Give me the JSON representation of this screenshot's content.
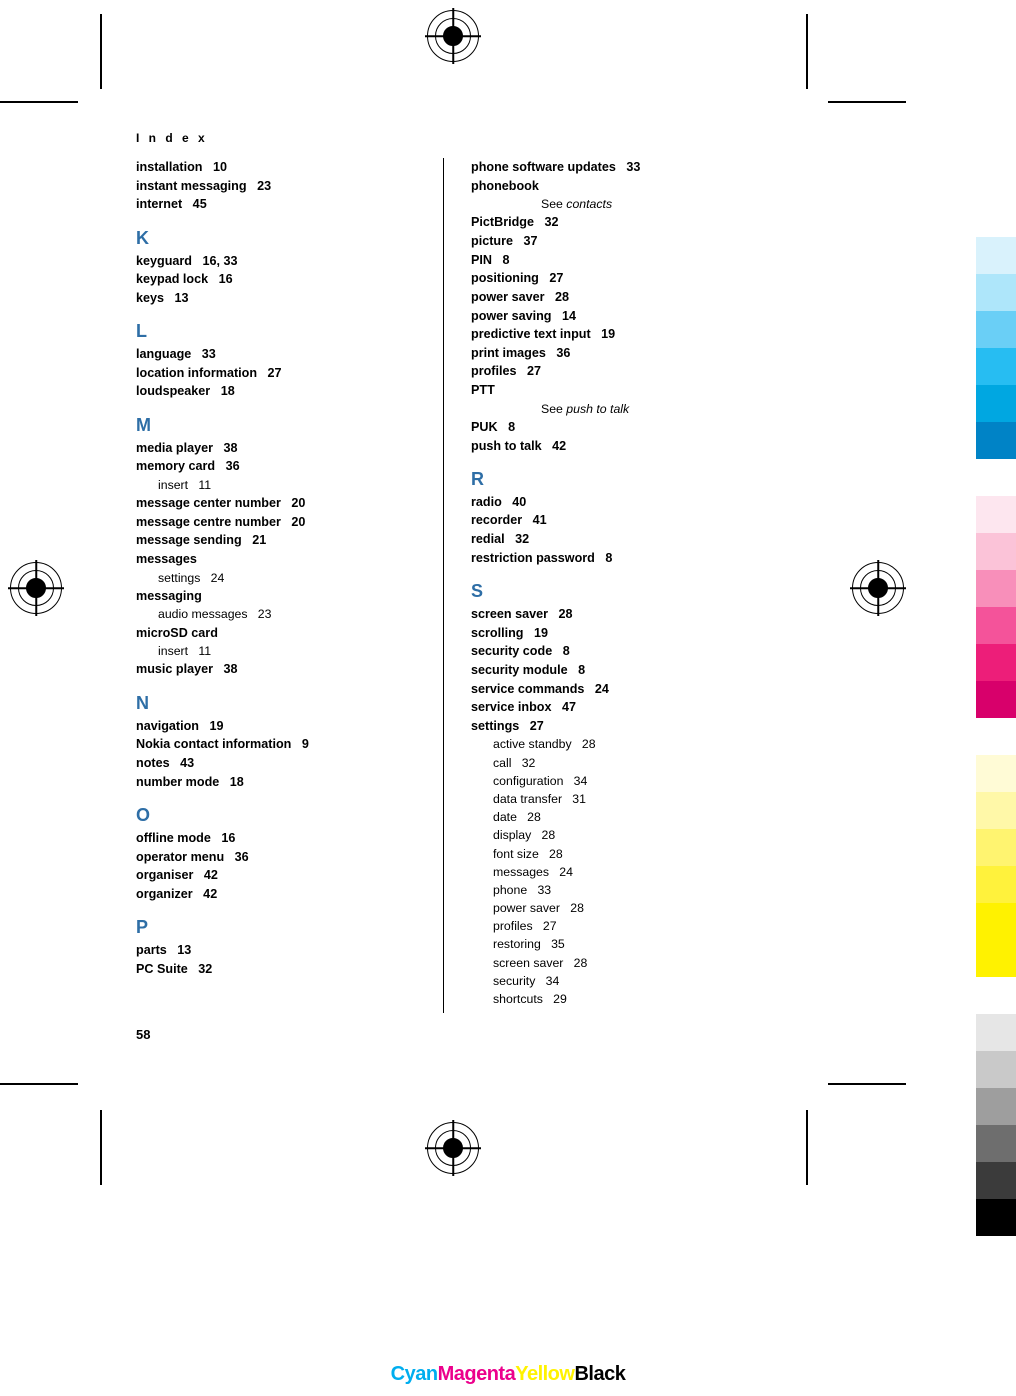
{
  "document": {
    "header": "I n d e x",
    "page_number": "58"
  },
  "columns": {
    "left": [
      {
        "type": "entry",
        "text": "installation",
        "page": "10"
      },
      {
        "type": "entry",
        "text": "instant messaging",
        "page": "23"
      },
      {
        "type": "entry",
        "text": "internet",
        "page": "45"
      },
      {
        "type": "letter",
        "text": "K"
      },
      {
        "type": "entry",
        "text": "keyguard",
        "page": "16, 33"
      },
      {
        "type": "entry",
        "text": "keypad lock",
        "page": "16"
      },
      {
        "type": "entry",
        "text": "keys",
        "page": "13"
      },
      {
        "type": "letter",
        "text": "L"
      },
      {
        "type": "entry",
        "text": "language",
        "page": "33"
      },
      {
        "type": "entry",
        "text": "location information",
        "page": "27"
      },
      {
        "type": "entry",
        "text": "loudspeaker",
        "page": "18"
      },
      {
        "type": "letter",
        "text": "M"
      },
      {
        "type": "entry",
        "text": "media player",
        "page": "38"
      },
      {
        "type": "entry",
        "text": "memory card",
        "page": "36"
      },
      {
        "type": "sub",
        "text": "insert",
        "page": "11"
      },
      {
        "type": "entry",
        "text": "message center number",
        "page": "20"
      },
      {
        "type": "entry",
        "text": "message centre number",
        "page": "20"
      },
      {
        "type": "entry",
        "text": "message sending",
        "page": "21"
      },
      {
        "type": "entry",
        "text": "messages",
        "page": ""
      },
      {
        "type": "sub",
        "text": "settings",
        "page": "24"
      },
      {
        "type": "entry",
        "text": "messaging",
        "page": ""
      },
      {
        "type": "sub",
        "text": "audio messages",
        "page": "23"
      },
      {
        "type": "entry",
        "text": "microSD card",
        "page": ""
      },
      {
        "type": "sub",
        "text": "insert",
        "page": "11"
      },
      {
        "type": "entry",
        "text": "music player",
        "page": "38"
      },
      {
        "type": "letter",
        "text": "N"
      },
      {
        "type": "entry",
        "text": "navigation",
        "page": "19"
      },
      {
        "type": "entry",
        "text": "Nokia contact information",
        "page": "9"
      },
      {
        "type": "entry",
        "text": "notes",
        "page": "43"
      },
      {
        "type": "entry",
        "text": "number mode",
        "page": "18"
      },
      {
        "type": "letter",
        "text": "O"
      },
      {
        "type": "entry",
        "text": "offline mode",
        "page": "16"
      },
      {
        "type": "entry",
        "text": "operator menu",
        "page": "36"
      },
      {
        "type": "entry",
        "text": "organiser",
        "page": "42"
      },
      {
        "type": "entry",
        "text": "organizer",
        "page": "42"
      },
      {
        "type": "letter",
        "text": "P"
      },
      {
        "type": "entry",
        "text": "parts",
        "page": "13"
      },
      {
        "type": "entry",
        "text": "PC Suite",
        "page": "32"
      }
    ],
    "right": [
      {
        "type": "entry",
        "text": "phone software updates",
        "page": "33"
      },
      {
        "type": "entry",
        "text": "phonebook",
        "page": ""
      },
      {
        "type": "see",
        "text": "See ",
        "italic": "contacts"
      },
      {
        "type": "entry",
        "text": "PictBridge",
        "page": "32"
      },
      {
        "type": "entry",
        "text": "picture",
        "page": "37"
      },
      {
        "type": "entry",
        "text": "PIN",
        "page": "8"
      },
      {
        "type": "entry",
        "text": "positioning",
        "page": "27"
      },
      {
        "type": "entry",
        "text": "power saver",
        "page": "28"
      },
      {
        "type": "entry",
        "text": "power saving",
        "page": "14"
      },
      {
        "type": "entry",
        "text": "predictive text input",
        "page": "19"
      },
      {
        "type": "entry",
        "text": "print images",
        "page": "36"
      },
      {
        "type": "entry",
        "text": "profiles",
        "page": "27"
      },
      {
        "type": "entry",
        "text": "PTT",
        "page": ""
      },
      {
        "type": "see",
        "text": "See ",
        "italic": "push to talk"
      },
      {
        "type": "entry",
        "text": "PUK",
        "page": "8"
      },
      {
        "type": "entry",
        "text": "push to talk",
        "page": "42"
      },
      {
        "type": "letter",
        "text": "R"
      },
      {
        "type": "entry",
        "text": "radio",
        "page": "40"
      },
      {
        "type": "entry",
        "text": "recorder",
        "page": "41"
      },
      {
        "type": "entry",
        "text": "redial",
        "page": "32"
      },
      {
        "type": "entry",
        "text": "restriction password",
        "page": "8"
      },
      {
        "type": "letter",
        "text": "S"
      },
      {
        "type": "entry",
        "text": "screen saver",
        "page": "28"
      },
      {
        "type": "entry",
        "text": "scrolling",
        "page": "19"
      },
      {
        "type": "entry",
        "text": "security code",
        "page": "8"
      },
      {
        "type": "entry",
        "text": "security module",
        "page": "8"
      },
      {
        "type": "entry",
        "text": "service commands",
        "page": "24"
      },
      {
        "type": "entry",
        "text": "service inbox",
        "page": "47"
      },
      {
        "type": "entry",
        "text": "settings",
        "page": "27"
      },
      {
        "type": "sub",
        "text": "active standby",
        "page": "28"
      },
      {
        "type": "sub",
        "text": "call",
        "page": "32"
      },
      {
        "type": "sub",
        "text": "configuration",
        "page": "34"
      },
      {
        "type": "sub",
        "text": "data transfer",
        "page": "31"
      },
      {
        "type": "sub",
        "text": "date",
        "page": "28"
      },
      {
        "type": "sub",
        "text": "display",
        "page": "28"
      },
      {
        "type": "sub",
        "text": "font size",
        "page": "28"
      },
      {
        "type": "sub",
        "text": "messages",
        "page": "24"
      },
      {
        "type": "sub",
        "text": "phone",
        "page": "33"
      },
      {
        "type": "sub",
        "text": "power saver",
        "page": "28"
      },
      {
        "type": "sub",
        "text": "profiles",
        "page": "27"
      },
      {
        "type": "sub",
        "text": "restoring",
        "page": "35"
      },
      {
        "type": "sub",
        "text": "screen saver",
        "page": "28"
      },
      {
        "type": "sub",
        "text": "security",
        "page": "34"
      },
      {
        "type": "sub",
        "text": "shortcuts",
        "page": "29"
      }
    ]
  },
  "print_marks": {
    "color_words": [
      {
        "label": "Cyan",
        "color": "#00AEEF"
      },
      {
        "label": "Magenta",
        "color": "#EC008C"
      },
      {
        "label": "Yellow",
        "color": "#FFF200"
      },
      {
        "label": "Black",
        "color": "#000000"
      }
    ],
    "color_bar_swatches": [
      "#FFFFFF",
      "#D9F2FC",
      "#AEE6FA",
      "#6ACFF6",
      "#27BDF2",
      "#00A7E1",
      "#0083C6",
      "#FFFFFF",
      "#FDE6EF",
      "#FBC3D8",
      "#F88FBA",
      "#F4539A",
      "#ED1E79",
      "#D8006B",
      "#FFFFFF",
      "#FFFBD6",
      "#FFF8A8",
      "#FFF470",
      "#FFF23C",
      "#FFF200",
      "#FFF200",
      "#FFFFFF",
      "#E6E6E6",
      "#C9C9C9",
      "#9E9E9E",
      "#6E6E6E",
      "#3B3B3B",
      "#000000"
    ]
  }
}
